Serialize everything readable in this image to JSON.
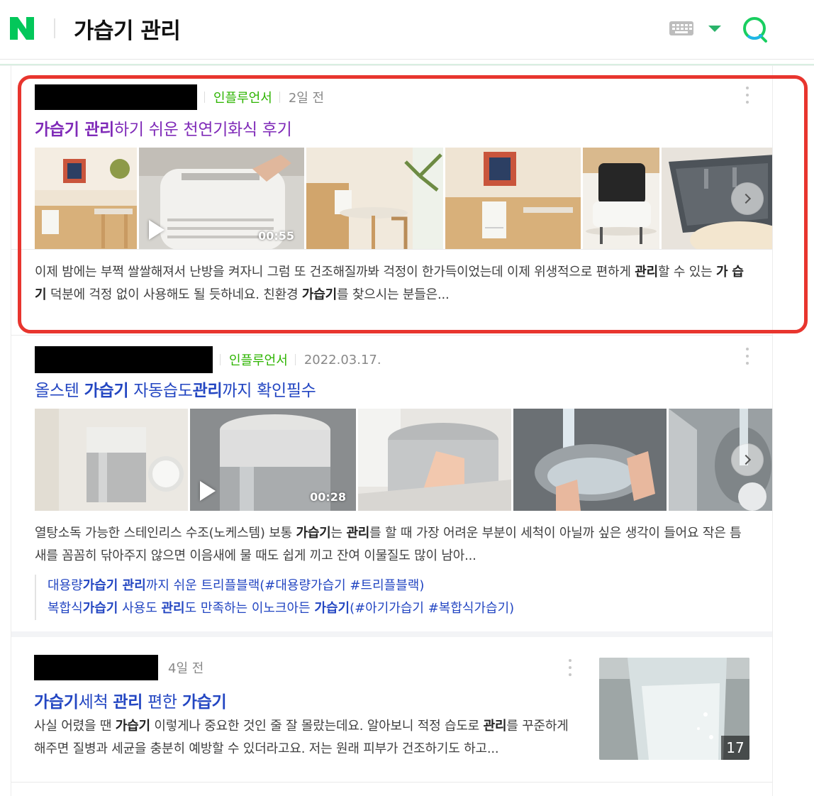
{
  "header": {
    "logo_letter": "N",
    "query": "가습기 관리",
    "keyboard_icon": "keyboard-icon",
    "dropdown_icon": "caret-down-icon",
    "search_icon": "search-icon",
    "accent_color": "#03c75a"
  },
  "results": [
    {
      "badge": "인플루언서",
      "date": "2일 전",
      "title_parts": [
        {
          "t": "가습기 관리",
          "b": true
        },
        {
          "t": "하기 쉬운 천연기화식 후기",
          "b": false
        }
      ],
      "video_duration": "00:55",
      "desc_parts": [
        {
          "t": "이제 밤에는 부쩍 쌀쌀해져서 난방을 켜자니 그럼 또 건조해질까봐 걱정이 한가득이었는데 이제 위생적으로 편하게 ",
          "b": false
        },
        {
          "t": "관리",
          "b": true
        },
        {
          "t": "할 수 있는 ",
          "b": false
        },
        {
          "t": "가 습 기",
          "b": true
        },
        {
          "t": " 덕분에 걱정 없이 사용해도 될 듯하네요. 친환경 ",
          "b": false
        },
        {
          "t": "가습기",
          "b": true
        },
        {
          "t": "를 찾으시는 분들은...",
          "b": false
        }
      ]
    },
    {
      "badge": "인플루언서",
      "date": "2022.03.17.",
      "title_parts": [
        {
          "t": "올스텐 ",
          "b": false
        },
        {
          "t": "가습기",
          "b": true
        },
        {
          "t": " 자동습도",
          "b": false
        },
        {
          "t": "관리",
          "b": true
        },
        {
          "t": "까지 확인필수",
          "b": false
        }
      ],
      "video_duration": "00:28",
      "desc_parts": [
        {
          "t": "열탕소독 가능한 스테인리스 수조(노케스템) 보통 ",
          "b": false
        },
        {
          "t": "가습기",
          "b": true
        },
        {
          "t": "는 ",
          "b": false
        },
        {
          "t": "관리",
          "b": true
        },
        {
          "t": "를 할 때 가장 어려운 부분이 세척이 아닐까 싶은 생각이 들어요 작은 틈새를 꼼꼼히 닦아주지 않으면 이음새에 물 때도 쉽게 끼고 잔여 이물질도 많이 남아...",
          "b": false
        }
      ],
      "related": [
        [
          {
            "t": "대용량",
            "b": false
          },
          {
            "t": "가습기 관리",
            "b": true
          },
          {
            "t": "까지 쉬운 트리플블랙(#대용량가습기 #트리플블랙)",
            "b": false
          }
        ],
        [
          {
            "t": "복합식",
            "b": false
          },
          {
            "t": "가습기",
            "b": true
          },
          {
            "t": " 사용도 ",
            "b": false
          },
          {
            "t": "관리",
            "b": true
          },
          {
            "t": "도 만족하는 이노크아든 ",
            "b": false
          },
          {
            "t": "가습기",
            "b": true
          },
          {
            "t": "(#아기가습기 #복합식가습기)",
            "b": false
          }
        ]
      ]
    },
    {
      "date": "4일 전",
      "title_parts": [
        {
          "t": "가습기",
          "b": true
        },
        {
          "t": "세척 ",
          "b": false
        },
        {
          "t": "관리",
          "b": true
        },
        {
          "t": " 편한 ",
          "b": false
        },
        {
          "t": "가습기",
          "b": true
        }
      ],
      "desc_parts": [
        {
          "t": "사실 어렸을 땐 ",
          "b": false
        },
        {
          "t": "가습기",
          "b": true
        },
        {
          "t": " 이렇게나 중요한 것인 줄 잘 몰랐는데요. 알아보니 적정 습도로 ",
          "b": false
        },
        {
          "t": "관리",
          "b": true
        },
        {
          "t": "를 꾸준하게 해주면 질병과 세균을 충분히 예방할 수 있더라고요. 저는 원래 피부가 건조하기도 하고...",
          "b": false
        }
      ],
      "image_count": "17"
    }
  ]
}
